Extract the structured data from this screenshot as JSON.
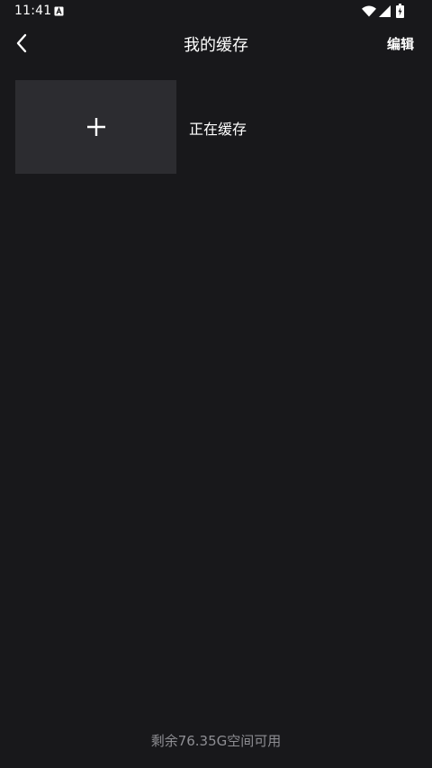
{
  "status_bar": {
    "time": "11:41"
  },
  "header": {
    "title": "我的缓存",
    "edit_label": "编辑"
  },
  "cache_item": {
    "label": "正在缓存"
  },
  "footer": {
    "storage_text": "剩余76.35G空间可用"
  },
  "icons": {
    "back": "chevron-left-icon",
    "add": "plus-icon",
    "notification": "notification-a-icon",
    "wifi": "wifi-icon",
    "signal": "cellular-signal-icon",
    "battery": "battery-charging-icon"
  },
  "colors": {
    "background": "#18181b",
    "thumbnail": "#2c2c30",
    "text_primary": "#ffffff",
    "text_secondary": "#8e8e93"
  }
}
